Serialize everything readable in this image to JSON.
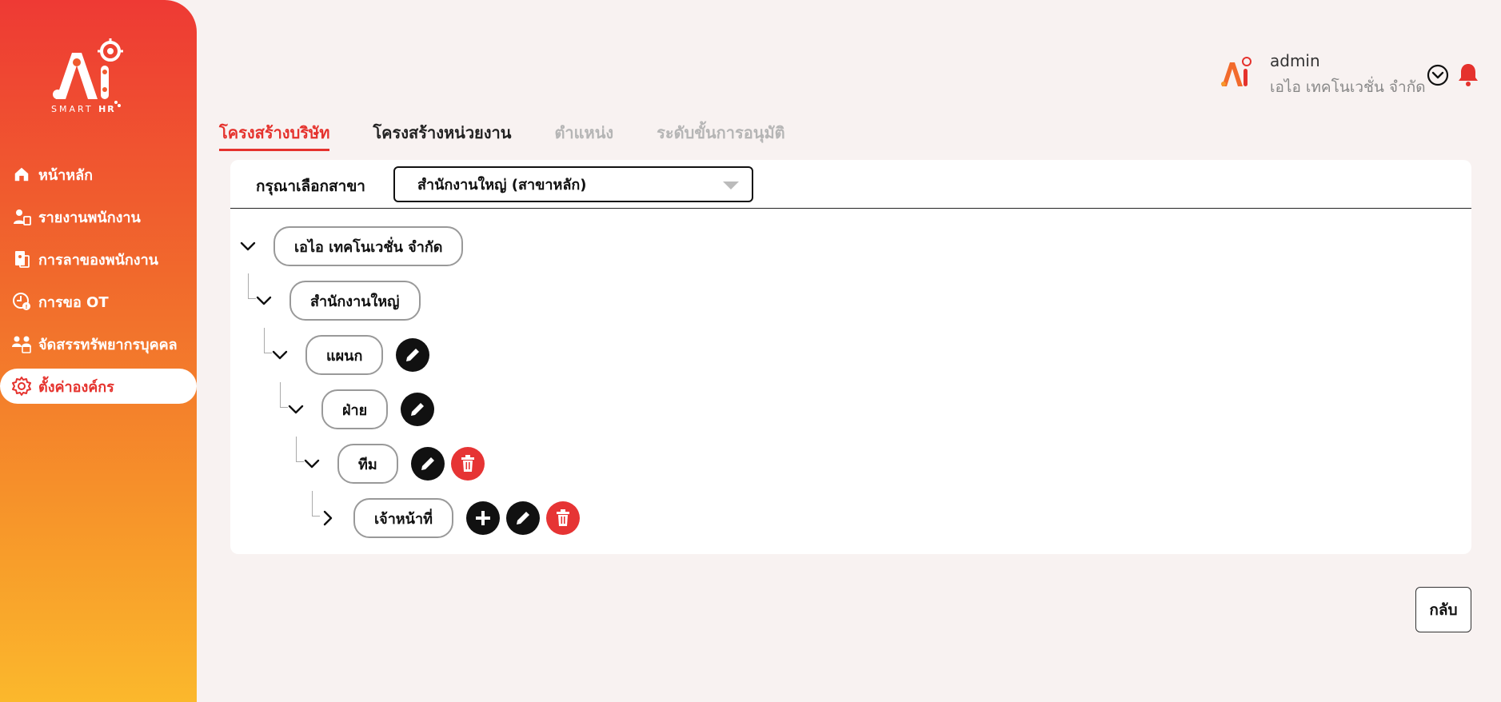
{
  "app": {
    "logo_text": "SMART",
    "logo_text_bold": "HR"
  },
  "sidebar": {
    "items": [
      {
        "label": "หน้าหลัก",
        "icon": "home-icon"
      },
      {
        "label": "รายงานพนักงาน",
        "icon": "user-report-icon"
      },
      {
        "label": "การลาของพนักงาน",
        "icon": "leave-document-icon"
      },
      {
        "label": "การขอ OT",
        "icon": "clock-ot-icon"
      },
      {
        "label": "จัดสรรทรัพยากรบุคคล",
        "icon": "people-group-icon"
      },
      {
        "label": "ตั้งค่าองค์กร",
        "icon": "gear-icon",
        "active": true
      }
    ]
  },
  "header": {
    "user_name": "admin",
    "company": "เอไอ เทคโนเวชั่น จำกัด"
  },
  "tabs": [
    {
      "label": "โครงสร้างบริษัท",
      "state": "active"
    },
    {
      "label": "โครงสร้างหน่วยงาน",
      "state": "normal"
    },
    {
      "label": "ตำแหน่ง",
      "state": "disabled"
    },
    {
      "label": "ระดับขั้นการอนุมัติ",
      "state": "disabled"
    }
  ],
  "branch": {
    "label": "กรุณาเลือกสาขา",
    "selected": "สำนักงานใหญ่ (สาขาหลัก)"
  },
  "tree": {
    "nodes": [
      {
        "label": "เอไอ เทคโนเวชั่น จำกัด",
        "expanded": true
      },
      {
        "label": "สำนักงานใหญ่",
        "expanded": true
      },
      {
        "label": "แผนก",
        "expanded": true
      },
      {
        "label": "ฝ่าย",
        "expanded": true
      },
      {
        "label": "ทีม",
        "expanded": true
      },
      {
        "label": "เจ้าหน้าที่",
        "expanded": false
      }
    ]
  },
  "actions": {
    "back_label": "กลับ"
  },
  "colors": {
    "accent": "#e5322d",
    "sidebar_top": "#ee3a34",
    "sidebar_bottom": "#fbb82c",
    "delete": "#e63434"
  }
}
